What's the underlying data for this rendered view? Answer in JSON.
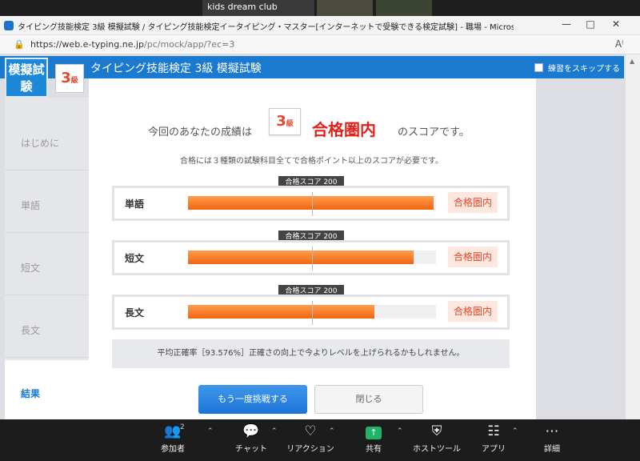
{
  "meeting": {
    "participant_name": "kids dream club"
  },
  "browser": {
    "window_title": "タイピング技能検定 3級 模擬試験 / タイピング技能検定イータイピング・マスター[インターネットで受験できる検定試験] - 職場 - Microsoft Edge",
    "url_main": "https://web.e-typing.ne.jp",
    "url_path": "/pc/mock/app/?ec=3",
    "icons": {
      "minimize": "minimize-icon",
      "maximize": "maximize-icon",
      "close": "close-icon",
      "lock": "lock-icon",
      "reader": "reader-icon"
    }
  },
  "header": {
    "logo_text": "模擬試験",
    "grade_num": "3",
    "grade_suffix": "級",
    "title": "タイピング技能検定 3級 模擬試験",
    "skip_label": "練習をスキップする"
  },
  "sidebar": {
    "items": [
      {
        "label": "はじめに"
      },
      {
        "label": "単語"
      },
      {
        "label": "短文"
      },
      {
        "label": "長文"
      },
      {
        "label": "結果"
      }
    ]
  },
  "result": {
    "pre": "今回のあなたの成績は",
    "grade_num": "3",
    "grade_suffix": "級",
    "main": "合格圏内",
    "post": "のスコアです。",
    "note": "合格には３種類の試験科目全てで合格ポイント以上のスコアが必要です。",
    "pass_score_label": "合格スコア 200",
    "rows": [
      {
        "label": "単語",
        "fill_fraction": 0.99,
        "status": "合格圏内"
      },
      {
        "label": "短文",
        "fill_fraction": 0.91,
        "status": "合格圏内"
      },
      {
        "label": "長文",
        "fill_fraction": 0.75,
        "status": "合格圏内"
      }
    ],
    "accuracy_text": "平均正確率［93.576%］正確さの向上で今よりレベルを上げられるかもしれません。",
    "retry_label": "もう一度挑戦する",
    "close_label": "閉じる"
  },
  "zoom": {
    "participants_count": "2",
    "buttons": [
      {
        "label": "参加者",
        "icon": "participants-icon"
      },
      {
        "label": "チャット",
        "icon": "chat-icon"
      },
      {
        "label": "リアクション",
        "icon": "reaction-icon"
      },
      {
        "label": "共有",
        "icon": "share-icon"
      },
      {
        "label": "ホストツール",
        "icon": "shield-icon"
      },
      {
        "label": "アプリ",
        "icon": "apps-icon"
      },
      {
        "label": "詳細",
        "icon": "more-icon"
      }
    ]
  },
  "colors": {
    "brand_blue": "#1a7ad0",
    "pass_red": "#e2211c",
    "bar_orange": "#f26510"
  }
}
